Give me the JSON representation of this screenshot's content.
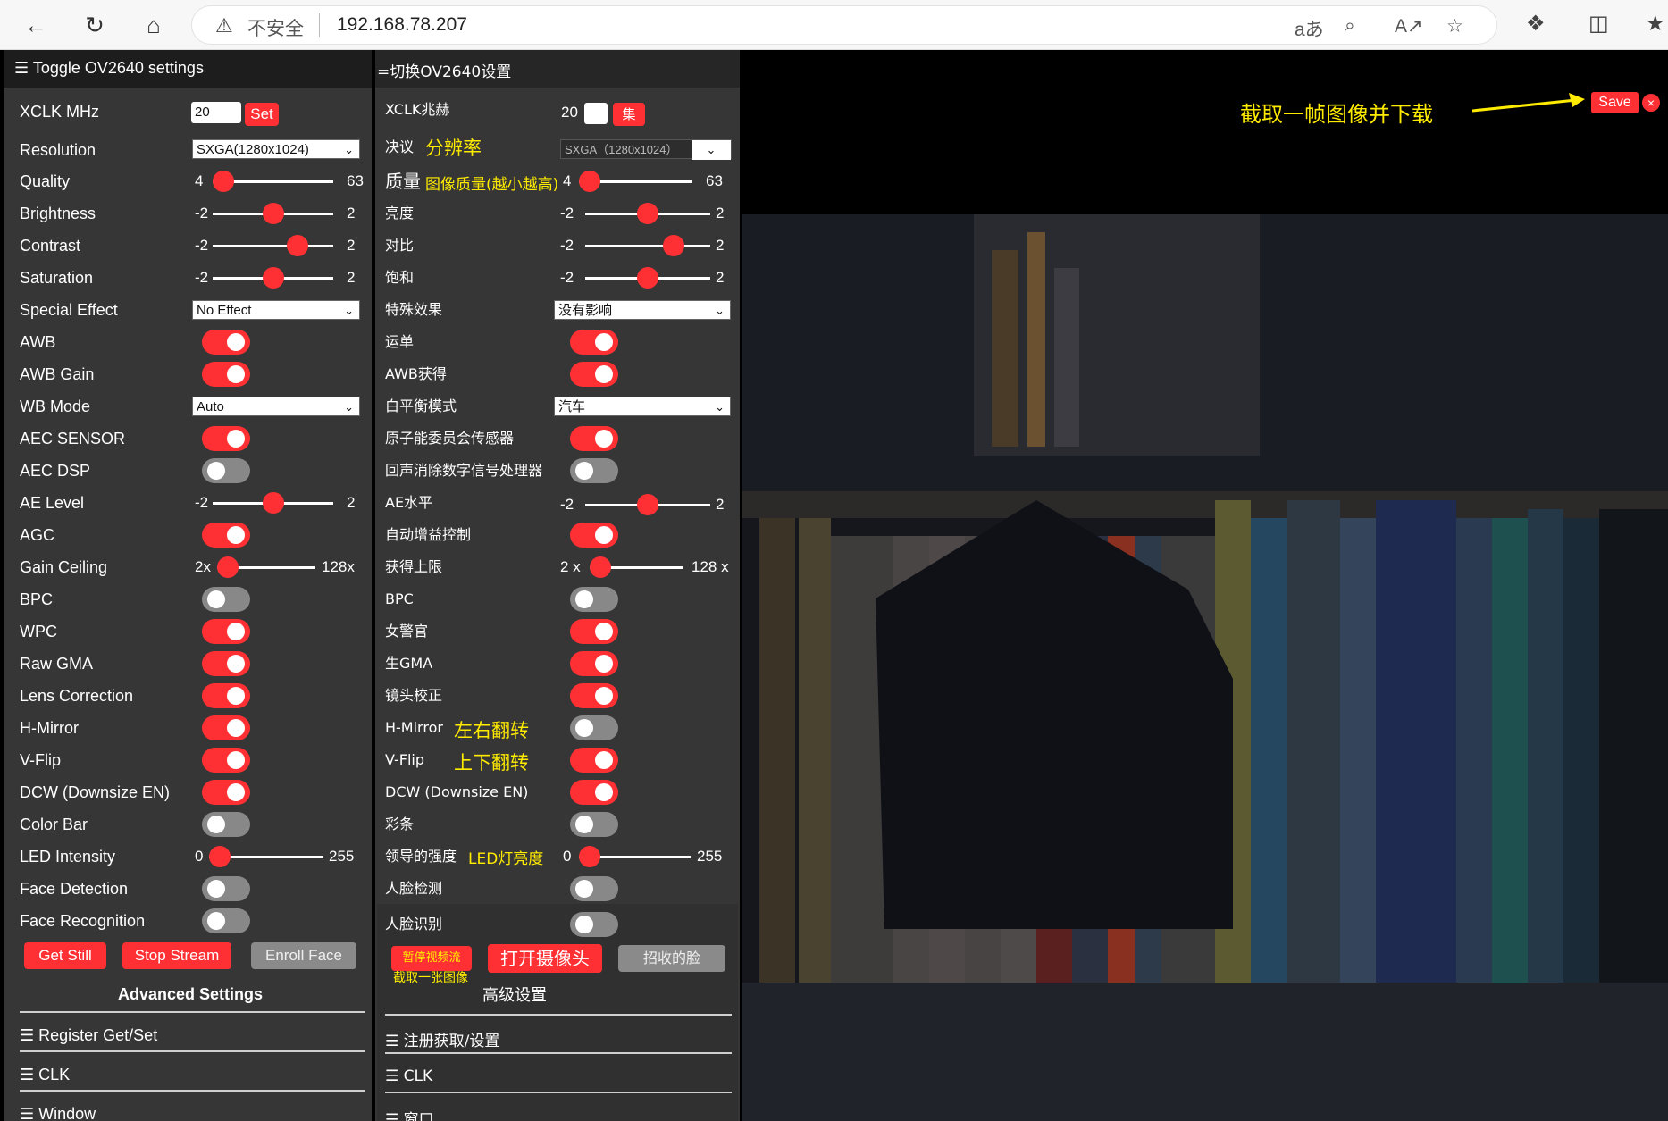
{
  "browser": {
    "insecure_label": "不安全",
    "url": "192.168.78.207",
    "read_aloud_label": "aあ"
  },
  "left_panel": {
    "title": "Toggle OV2640 settings",
    "xclk_label": "XCLK MHz",
    "xclk_value": "20",
    "set_button": "Set",
    "resolution_label": "Resolution",
    "resolution_value": "SXGA(1280x1024)",
    "quality": {
      "label": "Quality",
      "min": "4",
      "max": "63",
      "value": 4
    },
    "brightness": {
      "label": "Brightness",
      "min": "-2",
      "max": "2",
      "value": 0
    },
    "contrast": {
      "label": "Contrast",
      "min": "-2",
      "max": "2",
      "value": 1
    },
    "saturation": {
      "label": "Saturation",
      "min": "-2",
      "max": "2",
      "value": 0
    },
    "special_effect_label": "Special Effect",
    "special_effect_value": "No Effect",
    "awb_label": "AWB",
    "awb_gain_label": "AWB Gain",
    "wb_mode_label": "WB Mode",
    "wb_mode_value": "Auto",
    "aec_sensor_label": "AEC SENSOR",
    "aec_dsp_label": "AEC DSP",
    "ae_level": {
      "label": "AE Level",
      "min": "-2",
      "max": "2",
      "value": 0
    },
    "agc_label": "AGC",
    "gain_ceiling": {
      "label": "Gain Ceiling",
      "min": "2x",
      "max": "128x",
      "value": 0
    },
    "bpc_label": "BPC",
    "wpc_label": "WPC",
    "raw_gma_label": "Raw GMA",
    "lens_correction_label": "Lens Correction",
    "hmirror_label": "H-Mirror",
    "vflip_label": "V-Flip",
    "dcw_label": "DCW (Downsize EN)",
    "colorbar_label": "Color Bar",
    "led": {
      "label": "LED Intensity",
      "min": "0",
      "max": "255",
      "value": 0
    },
    "face_detection_label": "Face Detection",
    "face_recognition_label": "Face Recognition",
    "get_still": "Get Still",
    "stop_stream": "Stop Stream",
    "enroll_face": "Enroll Face",
    "advanced": "Advanced Settings",
    "register": "Register Get/Set",
    "clk": "CLK",
    "window": "Window"
  },
  "right_panel": {
    "title": "=切换OV2640设置",
    "xclk_label": "XCLK兆赫",
    "xclk_value": "20",
    "set_button": "集",
    "resolution_label": "决议",
    "resolution_ann": "分辨率",
    "resolution_value": "SXGA（1280x1024）",
    "quality_label": "质量",
    "quality_ann": "图像质量(越小越高)",
    "quality_min": "4",
    "quality_max": "63",
    "brightness_label": "亮度",
    "contrast_label": "对比",
    "saturation_label": "饱和",
    "special_effect_label": "特殊效果",
    "special_effect_value": "没有影响",
    "awb_label": "运单",
    "awb_gain_label": "AWB获得",
    "wb_mode_label": "白平衡模式",
    "wb_mode_value": "汽车",
    "aec_sensor_label": "原子能委员会传感器",
    "aec_dsp_label": "回声消除数字信号处理器",
    "ae_level_label": "AE水平",
    "agc_label": "自动增益控制",
    "gain_ceiling_label": "获得上限",
    "gain_min": "2 x",
    "gain_max": "128 x",
    "bpc_label": "BPC",
    "wpc_label": "女警官",
    "raw_gma_label": "生GMA",
    "lens_label": "镜头校正",
    "hmirror_label": "H-Mirror",
    "hmirror_ann": "左右翻转",
    "vflip_label": "V-Flip",
    "vflip_ann": "上下翻转",
    "dcw_label": "DCW (Downsize EN)",
    "colorbar_label": "彩条",
    "led_label": "领导的强度",
    "led_ann": "LED灯亮度",
    "face_detect_label": "人脸检测",
    "face_recog_label": "人脸识别",
    "pause_btn": "暂停视频流",
    "capture_ann": "截取一张图像",
    "open_cam_btn": "打开摄像头",
    "enroll_btn": "招收的脸",
    "advanced": "高级设置",
    "register": "注册获取/设置",
    "clk": "CLK",
    "window": "窗口"
  },
  "capture": {
    "annotation": "截取一帧图像并下载",
    "save": "Save",
    "close": "×"
  },
  "colors": {
    "accent": "#ff3034",
    "panel": "#363636",
    "annotation": "#ffeb00"
  }
}
